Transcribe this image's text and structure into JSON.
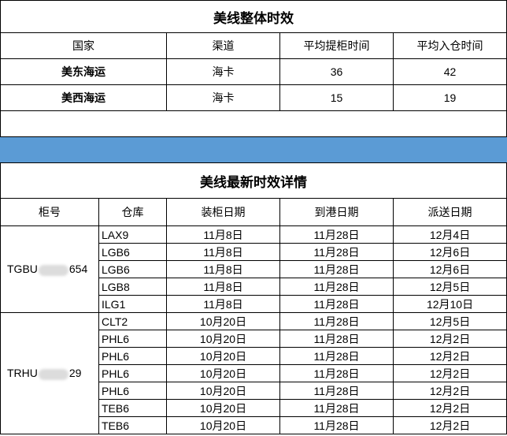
{
  "summary": {
    "title": "美线整体时效",
    "headers": [
      "国家",
      "渠道",
      "平均提柜时间",
      "平均入仓时间"
    ],
    "rows": [
      {
        "country": "美东海运",
        "channel": "海卡",
        "pickup": "36",
        "warehouse": "42"
      },
      {
        "country": "美西海运",
        "channel": "海卡",
        "pickup": "15",
        "warehouse": "19"
      }
    ]
  },
  "band_color": "#5b9bd5",
  "detail": {
    "title": "美线最新时效详情",
    "headers": [
      "柜号",
      "仓库",
      "装柜日期",
      "到港日期",
      "派送日期"
    ],
    "containers": [
      {
        "prefix": "TGBU",
        "suffix": "654",
        "rows": [
          {
            "warehouse": "LAX9",
            "load": "11月8日",
            "arrive": "11月28日",
            "deliver": "12月4日"
          },
          {
            "warehouse": "LGB6",
            "load": "11月8日",
            "arrive": "11月28日",
            "deliver": "12月6日"
          },
          {
            "warehouse": "LGB6",
            "load": "11月8日",
            "arrive": "11月28日",
            "deliver": "12月6日"
          },
          {
            "warehouse": "LGB8",
            "load": "11月8日",
            "arrive": "11月28日",
            "deliver": "12月5日"
          },
          {
            "warehouse": "ILG1",
            "load": "11月8日",
            "arrive": "11月28日",
            "deliver": "12月10日"
          }
        ]
      },
      {
        "prefix": "TRHU",
        "suffix": "29",
        "rows": [
          {
            "warehouse": "CLT2",
            "load": "10月20日",
            "arrive": "11月28日",
            "deliver": "12月5日"
          },
          {
            "warehouse": "PHL6",
            "load": "10月20日",
            "arrive": "11月28日",
            "deliver": "12月2日"
          },
          {
            "warehouse": "PHL6",
            "load": "10月20日",
            "arrive": "11月28日",
            "deliver": "12月2日"
          },
          {
            "warehouse": "PHL6",
            "load": "10月20日",
            "arrive": "11月28日",
            "deliver": "12月2日"
          },
          {
            "warehouse": "PHL6",
            "load": "10月20日",
            "arrive": "11月28日",
            "deliver": "12月2日"
          },
          {
            "warehouse": "TEB6",
            "load": "10月20日",
            "arrive": "11月28日",
            "deliver": "12月2日"
          },
          {
            "warehouse": "TEB6",
            "load": "10月20日",
            "arrive": "11月28日",
            "deliver": "12月2日"
          }
        ]
      }
    ]
  }
}
